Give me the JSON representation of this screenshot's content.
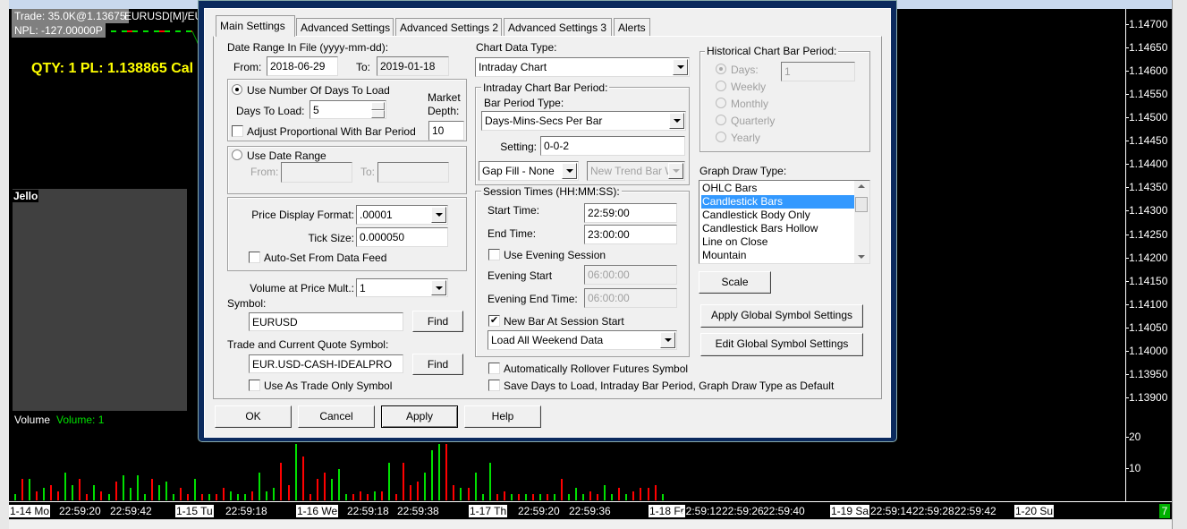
{
  "chart": {
    "trade_info": "Trade: 35.0K@1.13675",
    "symbol_title": "EURUSD[M]/EU",
    "npl": "NPL: -127.00000P",
    "qty_pl": "QTY: 1  PL: 1.138865 Cal",
    "study_label": "Jello",
    "volume_label": "Volume",
    "volume_value": "Volume: 1",
    "price_axis": [
      "1.14700",
      "1.14650",
      "1.14600",
      "1.14550",
      "1.14500",
      "1.14450",
      "1.14400",
      "1.14350",
      "1.14300",
      "1.14250",
      "1.14200",
      "1.14150",
      "1.14100",
      "1.14050",
      "1.14000",
      "1.13950",
      "1.13900"
    ],
    "volume_axis": [
      "20",
      "10"
    ],
    "time_axis": [
      {
        "text": "1-14 Mo",
        "date": true
      },
      {
        "text": "22:59:20",
        "date": false
      },
      {
        "text": "22:59:42",
        "date": false
      },
      {
        "text": "1-15 Tu",
        "date": true
      },
      {
        "text": "22:59:18",
        "date": false
      },
      {
        "text": "1-16 We",
        "date": true
      },
      {
        "text": "22:59:18",
        "date": false
      },
      {
        "text": "22:59:38",
        "date": false
      },
      {
        "text": "1-17 Th",
        "date": true
      },
      {
        "text": "22:59:20",
        "date": false
      },
      {
        "text": "22:59:36",
        "date": false
      },
      {
        "text": "1-18 Fr",
        "date": true
      },
      {
        "text": "22:59:12",
        "date": false
      },
      {
        "text": "22:59:26",
        "date": false
      },
      {
        "text": "22:59:40",
        "date": false
      },
      {
        "text": "1-19 Sa",
        "date": true
      },
      {
        "text": "22:59:14",
        "date": false
      },
      {
        "text": "22:59:28",
        "date": false
      },
      {
        "text": "22:59:42",
        "date": false
      },
      {
        "text": "1-20 Su",
        "date": true
      }
    ],
    "corner_badge": "7",
    "colors": {
      "up": "#00e000",
      "down": "#ff0000",
      "text": "#ffff00"
    },
    "volume_bars": {
      "colors": "grgrgrrggrrgrgrgggrggggrrgrgrrgggrgggrrgrrrggggrrrgrgrrrgggrrgr",
      "dirs": [
        "g",
        "r",
        "g",
        "r",
        "g",
        "r",
        "r",
        "g",
        "g",
        "r",
        "r",
        "g",
        "r",
        "g",
        "r",
        "g",
        "g",
        "g",
        "g",
        "r",
        "g",
        "g",
        "g",
        "r",
        "r",
        "g",
        "r",
        "g",
        "r",
        "r",
        "g",
        "g",
        "g",
        "r",
        "g",
        "g",
        "g",
        "r",
        "r",
        "g",
        "r",
        "r",
        "r",
        "r",
        "g",
        "g",
        "g",
        "r",
        "r",
        "r",
        "g",
        "r",
        "g",
        "r",
        "r",
        "r",
        "r",
        "g",
        "g",
        "g",
        "r",
        "r",
        "g",
        "r",
        "g",
        "g",
        "g",
        "r",
        "r",
        "g",
        "r",
        "g",
        "r",
        "g",
        "r",
        "g",
        "r",
        "g",
        "g",
        "g",
        "r",
        "r",
        "g",
        "g",
        "r",
        "g",
        "r",
        "r",
        "r",
        "r",
        "g"
      ],
      "values": [
        2,
        7,
        7,
        3,
        4,
        5,
        3,
        9,
        5,
        7,
        2,
        5,
        3,
        2,
        6,
        8,
        4,
        8,
        2,
        7,
        5,
        6,
        2,
        4,
        2,
        7,
        2,
        2,
        2,
        4,
        3,
        2,
        2,
        3,
        9,
        3,
        4,
        12,
        5,
        18,
        14,
        2,
        7,
        9,
        7,
        10,
        2,
        2,
        3,
        2,
        3,
        3,
        12,
        2,
        12,
        5,
        6,
        9,
        16,
        18,
        18,
        5,
        4,
        4,
        9,
        2,
        12,
        2,
        3,
        2,
        2,
        2,
        2,
        2,
        2,
        2,
        7,
        2,
        4,
        2,
        3,
        2,
        5,
        2,
        4,
        2,
        3,
        4,
        4,
        5,
        2
      ]
    }
  },
  "dialog": {
    "tabs": [
      "Main Settings",
      "Advanced Settings",
      "Advanced Settings 2",
      "Advanced Settings 3",
      "Alerts"
    ],
    "date_range_label": "Date Range In File (yyyy-mm-dd):",
    "from_label": "From:",
    "from_value": "2018-06-29",
    "to_label": "To:",
    "to_value": "2019-01-18",
    "use_days_label": "Use Number Of Days To Load",
    "days_to_load_label": "Days To Load:",
    "days_to_load_value": "5",
    "market_depth_label1": "Market",
    "market_depth_label2": "Depth:",
    "market_depth_value": "10",
    "adjust_label": "Adjust Proportional With Bar Period",
    "use_date_range_label": "Use Date Range",
    "range_from_label": "From:",
    "range_to_label": "To:",
    "price_format_label": "Price Display Format:",
    "price_format_value": ".00001",
    "tick_size_label": "Tick Size:",
    "tick_size_value": "0.000050",
    "auto_set_label": "Auto-Set From Data Feed",
    "vap_label": "Volume at Price Mult.:",
    "vap_value": "1",
    "symbol_label": "Symbol:",
    "symbol_value": "EURUSD",
    "find_label": "Find",
    "trade_symbol_label": "Trade and Current Quote Symbol:",
    "trade_symbol_value": "EUR.USD-CASH-IDEALPRO",
    "trade_only_label": "Use As Trade Only Symbol",
    "chart_data_type_label": "Chart Data Type:",
    "chart_data_type_value": "Intraday Chart",
    "intraday_group": "Intraday Chart Bar Period:",
    "bar_period_type_label": "Bar Period Type:",
    "bar_period_type_value": "Days-Mins-Secs Per Bar",
    "setting_label": "Setting:",
    "setting_value": "0-0-2",
    "gap_fill_value": "Gap Fill - None",
    "new_trend_value": "New Trend Bar W",
    "session_group": "Session Times (HH:MM:SS):",
    "start_time_label": "Start Time:",
    "start_time_value": "22:59:00",
    "end_time_label": "End Time:",
    "end_time_value": "23:00:00",
    "use_evening_label": "Use Evening Session",
    "evening_start_label": "Evening Start",
    "evening_start_value": "06:00:00",
    "evening_end_label": "Evening End Time:",
    "evening_end_value": "06:00:00",
    "new_bar_label": "New Bar At Session Start",
    "weekend_value": "Load All Weekend Data",
    "rollover_label": "Automatically Rollover Futures Symbol",
    "save_default_label": "Save Days to Load, Intraday Bar Period, Graph Draw Type as Default",
    "historical_group": "Historical Chart Bar Period:",
    "hist_days_label": "Days:",
    "hist_days_value": "1",
    "hist_weekly": "Weekly",
    "hist_monthly": "Monthly",
    "hist_quarterly": "Quarterly",
    "hist_yearly": "Yearly",
    "graph_draw_label": "Graph Draw Type:",
    "graph_draw_items": [
      "OHLC Bars",
      "Candlestick Bars",
      "Candlestick Body Only",
      "Candlestick Bars Hollow",
      "Line on Close",
      "Mountain"
    ],
    "graph_draw_selected": "Candlestick Bars",
    "scale_button": "Scale",
    "apply_global_button": "Apply Global Symbol Settings",
    "edit_global_button": "Edit Global Symbol Settings",
    "ok_button": "OK",
    "cancel_button": "Cancel",
    "apply_button": "Apply",
    "help_button": "Help"
  }
}
